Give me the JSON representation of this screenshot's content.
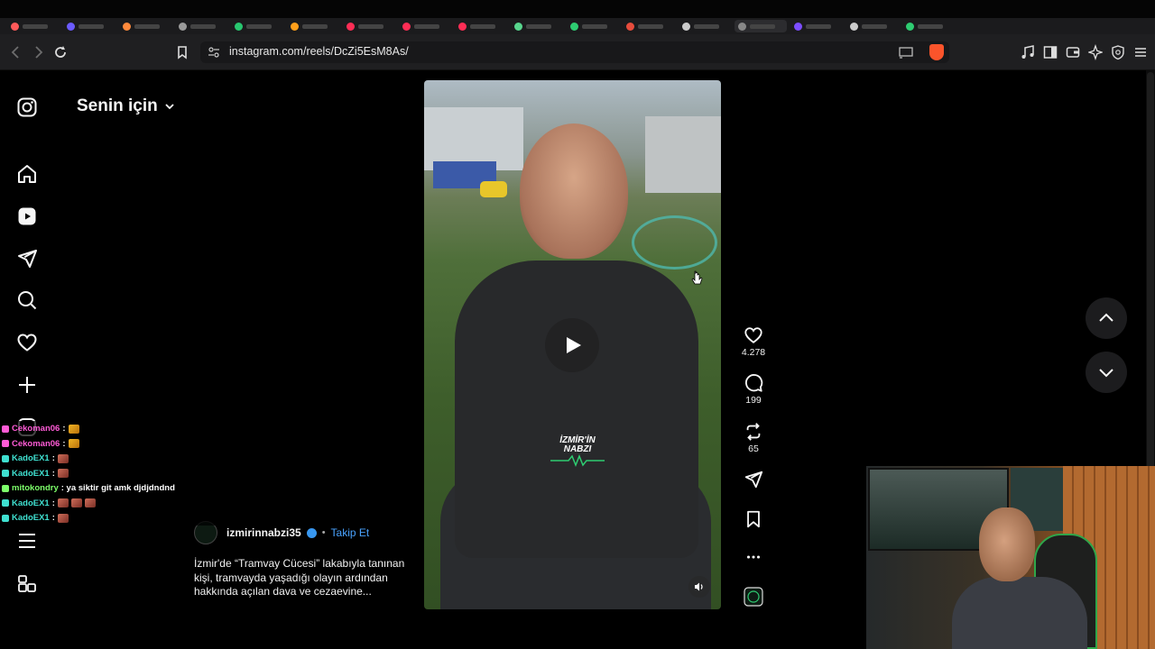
{
  "browser": {
    "url": "instagram.com/reels/DcZi5EsM8As/",
    "tab_colors": [
      "#ff5a5a",
      "#6b5bff",
      "#ff8a3c",
      "#9a9a9a",
      "#28c76f",
      "#ff9f1a",
      "#ff2d55",
      "#ff2d55",
      "#ff2d55",
      "#58d68d",
      "#2ecc71",
      "#e74c3c",
      "#cccccc",
      "#888888",
      "#7c4dff",
      "#cccccc",
      "#2ecc71"
    ]
  },
  "feed": {
    "title": "Senin için",
    "dropdown_icon": "chevron-down-icon"
  },
  "sidebar": {
    "items": [
      {
        "icon": "instagram-logo-icon"
      },
      {
        "icon": "home-icon"
      },
      {
        "icon": "reels-icon"
      },
      {
        "icon": "direct-message-icon"
      },
      {
        "icon": "search-icon"
      },
      {
        "icon": "notifications-heart-icon"
      },
      {
        "icon": "create-plus-icon"
      },
      {
        "icon": "profile-icon"
      },
      {
        "icon": "menu-icon"
      },
      {
        "icon": "more-apps-icon"
      }
    ]
  },
  "video": {
    "watermark_line1": "İZMİR'İN",
    "watermark_line2": "NABZI"
  },
  "actions": {
    "likes": "4.278",
    "comments": "199",
    "reposts": "65"
  },
  "post": {
    "author": "izmirinnabzi35",
    "separator": "•",
    "follow_label": "Takip Et",
    "caption": "İzmir'de “Tramvay Cücesi” lakabıyla tanınan kişi, tramvayda yaşadığı olayın ardından hakkında açılan dava ve cezaevine..."
  },
  "chat": {
    "messages": [
      {
        "nick": "Cekoman06",
        "color": "#ff5bd6",
        "text": ":",
        "emotes": 1,
        "emote_color": "gold"
      },
      {
        "nick": "Cekoman06",
        "color": "#ff5bd6",
        "text": ":",
        "emotes": 1,
        "emote_color": "gold"
      },
      {
        "nick": "KadoEX1",
        "color": "#3fe0d0",
        "text": ":",
        "emotes": 1,
        "emote_color": "red"
      },
      {
        "nick": "KadoEX1",
        "color": "#3fe0d0",
        "text": ":",
        "emotes": 1,
        "emote_color": "red"
      },
      {
        "nick": "mitokondry",
        "color": "#7dff6a",
        "text": ": ya siktir git amk djdjdndnd",
        "emotes": 0,
        "emote_color": "none"
      },
      {
        "nick": "KadoEX1",
        "color": "#3fe0d0",
        "text": ":",
        "emotes": 3,
        "emote_color": "red"
      },
      {
        "nick": "KadoEX1",
        "color": "#3fe0d0",
        "text": ":",
        "emotes": 1,
        "emote_color": "red"
      }
    ]
  }
}
